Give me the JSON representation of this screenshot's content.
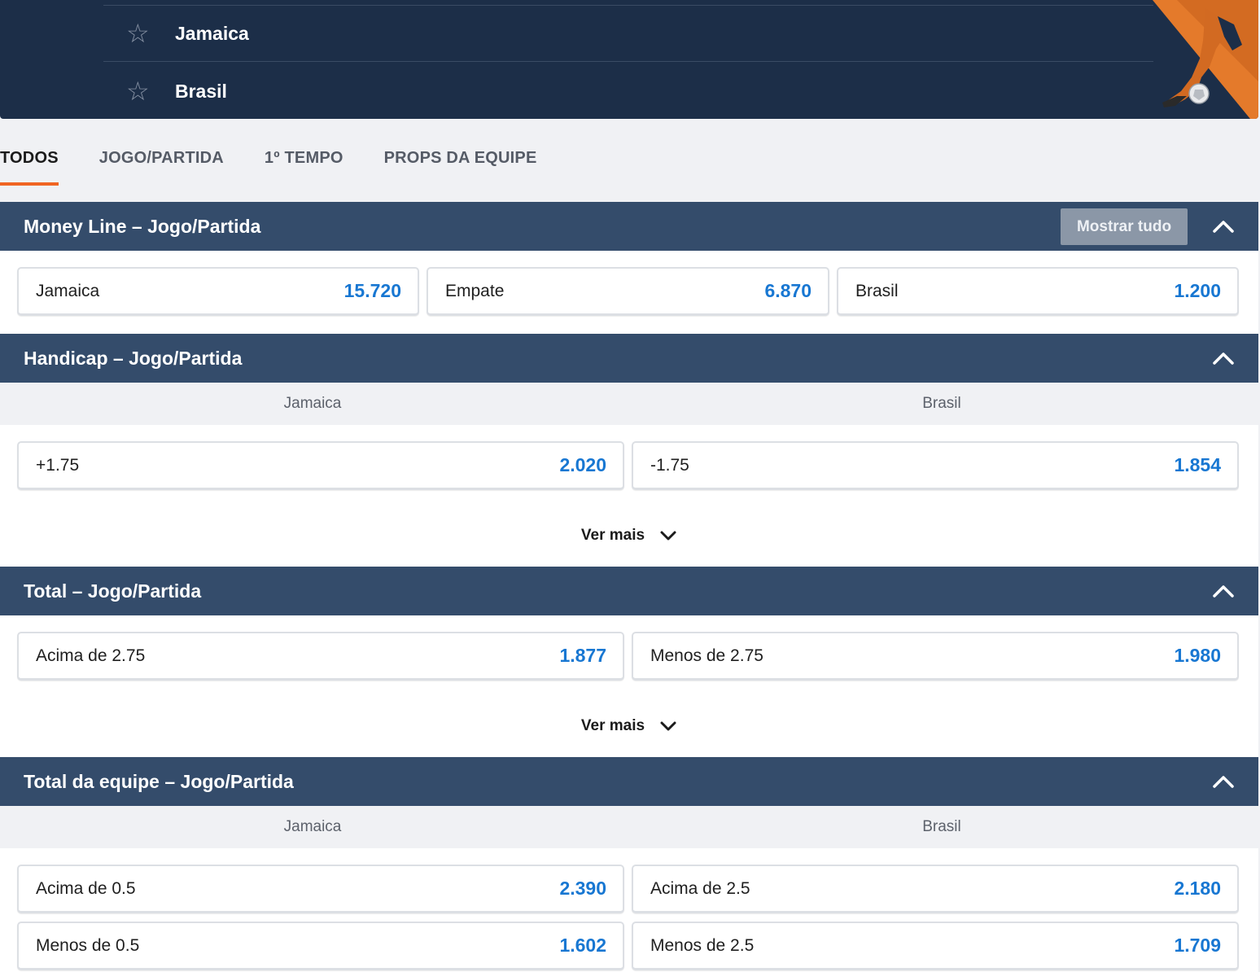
{
  "header": {
    "teams": [
      {
        "name": "Jamaica",
        "star": "☆"
      },
      {
        "name": "Brasil",
        "star": "☆"
      }
    ]
  },
  "tabs": [
    {
      "label": "TODOS",
      "active": true
    },
    {
      "label": "JOGO/PARTIDA",
      "active": false
    },
    {
      "label": "1º TEMPO",
      "active": false
    },
    {
      "label": "PROPS DA EQUIPE",
      "active": false
    }
  ],
  "markets": {
    "moneyline": {
      "title": "Money Line – Jogo/Partida",
      "show_all": "Mostrar tudo",
      "odds": [
        {
          "label": "Jamaica",
          "price": "15.720"
        },
        {
          "label": "Empate",
          "price": "6.870"
        },
        {
          "label": "Brasil",
          "price": "1.200"
        }
      ]
    },
    "handicap": {
      "title": "Handicap – Jogo/Partida",
      "columns": [
        "Jamaica",
        "Brasil"
      ],
      "odds": [
        {
          "label": "+1.75",
          "price": "2.020"
        },
        {
          "label": "-1.75",
          "price": "1.854"
        }
      ],
      "more": "Ver mais"
    },
    "total": {
      "title": "Total – Jogo/Partida",
      "odds": [
        {
          "label": "Acima de 2.75",
          "price": "1.877"
        },
        {
          "label": "Menos de 2.75",
          "price": "1.980"
        }
      ],
      "more": "Ver mais"
    },
    "team_total": {
      "title": "Total da equipe – Jogo/Partida",
      "columns": [
        "Jamaica",
        "Brasil"
      ],
      "odds": [
        {
          "label": "Acima de 0.5",
          "price": "2.390"
        },
        {
          "label": "Acima de 2.5",
          "price": "2.180"
        },
        {
          "label": "Menos de 0.5",
          "price": "1.602"
        },
        {
          "label": "Menos de 2.5",
          "price": "1.709"
        }
      ]
    }
  },
  "colors": {
    "header_bg": "#1c2e48",
    "section_bg": "#344c6b",
    "accent": "#f06522",
    "price": "#1877d2"
  },
  "icons": {
    "favorite": "star-outline-icon",
    "collapse": "chevron-up-icon",
    "expand": "chevron-down-icon"
  }
}
